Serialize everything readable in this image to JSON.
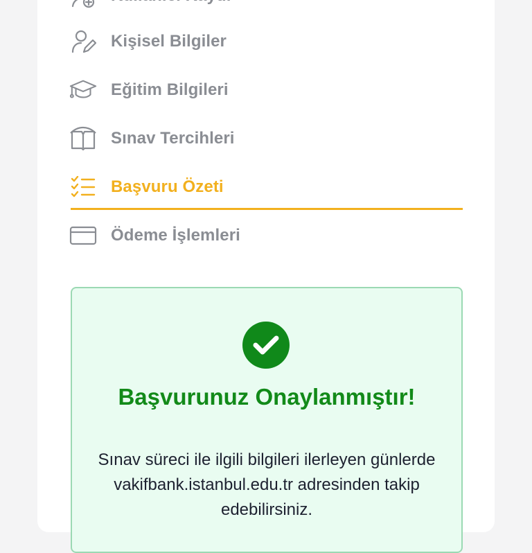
{
  "steps": [
    {
      "label": "Kullanıcı Kaydı",
      "icon": "user-plus-icon",
      "state": "done"
    },
    {
      "label": "Kişisel Bilgiler",
      "icon": "user-edit-icon",
      "state": "done"
    },
    {
      "label": "Eğitim Bilgileri",
      "icon": "graduation-cap-icon",
      "state": "done"
    },
    {
      "label": "Sınav Tercihleri",
      "icon": "book-open-icon",
      "state": "done"
    },
    {
      "label": "Başvuru Özeti",
      "icon": "checklist-icon",
      "state": "active"
    },
    {
      "label": "Ödeme İşlemleri",
      "icon": "credit-card-icon",
      "state": "pending"
    }
  ],
  "colors": {
    "active": "#f2b01e",
    "inactive": "#8a8d93",
    "success": "#128a19",
    "success_bg": "#e9fcf1",
    "success_border": "#9bd9b3"
  },
  "success": {
    "icon": "check-circle-icon",
    "title": "Başvurunuz Onaylanmıştır!",
    "message": "Sınav süreci ile ilgili bilgileri ilerleyen günlerde vakifbank.istanbul.edu.tr adresinden takip edebilirsiniz."
  }
}
